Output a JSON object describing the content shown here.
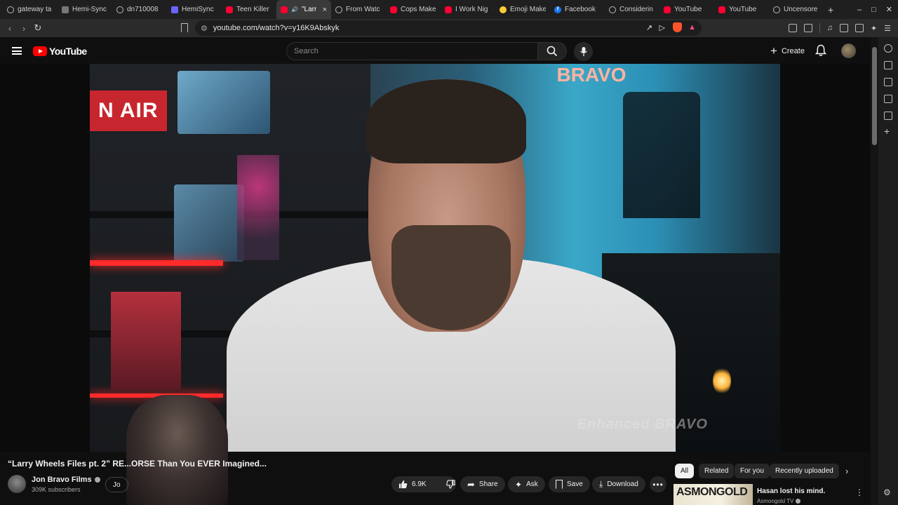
{
  "browser": {
    "tabs": [
      {
        "label": "gateway ta",
        "icon": "generic-site-icon",
        "active": false
      },
      {
        "label": "Hemi-Sync",
        "icon": "document-icon",
        "active": false
      },
      {
        "label": "dn710008",
        "icon": "generic-site-icon",
        "active": false
      },
      {
        "label": "HemiSync",
        "icon": "brave-search-icon",
        "active": false
      },
      {
        "label": "Teen Killer",
        "icon": "youtube-icon",
        "active": false
      },
      {
        "label": "\"Larr",
        "icon": "youtube-icon",
        "active": true
      },
      {
        "label": "From Watc",
        "icon": "generic-site-icon",
        "active": false
      },
      {
        "label": "Cops Make",
        "icon": "youtube-icon",
        "active": false
      },
      {
        "label": "I Work Nig",
        "icon": "youtube-icon",
        "active": false
      },
      {
        "label": "Emoji Make",
        "icon": "emoji-icon",
        "active": false
      },
      {
        "label": "Facebook",
        "icon": "facebook-icon",
        "active": false
      },
      {
        "label": "Considerin",
        "icon": "generic-site-icon",
        "active": false
      },
      {
        "label": "YouTube",
        "icon": "youtube-icon",
        "active": false
      },
      {
        "label": "YouTube",
        "icon": "youtube-icon",
        "active": false
      },
      {
        "label": "Uncensore",
        "icon": "generic-site-icon",
        "active": false
      }
    ],
    "url": "youtube.com/watch?v=y16K9Abskyk"
  },
  "youtube": {
    "logo_text": "YouTube",
    "search_placeholder": "Search",
    "create_label": "Create"
  },
  "video": {
    "title": "“Larry Wheels Files pt. 2” RE...ORSE Than You EVER Imagined...",
    "channel_name": "Jon Bravo Films",
    "subscribers": "309K subscribers",
    "join_label": "Jo",
    "likes": "6.9K",
    "share_label": "Share",
    "ask_label": "Ask",
    "save_label": "Save",
    "download_label": "Download",
    "set_text_left": "N AIR",
    "set_text_sign": "BRAVO",
    "watermark": "Enhanced BRAVO"
  },
  "chips": [
    {
      "label": "All",
      "active": true
    },
    {
      "label": "Related",
      "active": false
    },
    {
      "label": "For you",
      "active": false
    },
    {
      "label": "Recently uploaded",
      "active": false
    }
  ],
  "suggested": {
    "thumb_text": "ASMONGOLD",
    "title": "Hasan lost his mind.",
    "channel": "Asmongold TV"
  },
  "colors": {
    "background": "#0f0f0f",
    "youtube_red": "#ff0000",
    "chip_bg": "#272727"
  }
}
